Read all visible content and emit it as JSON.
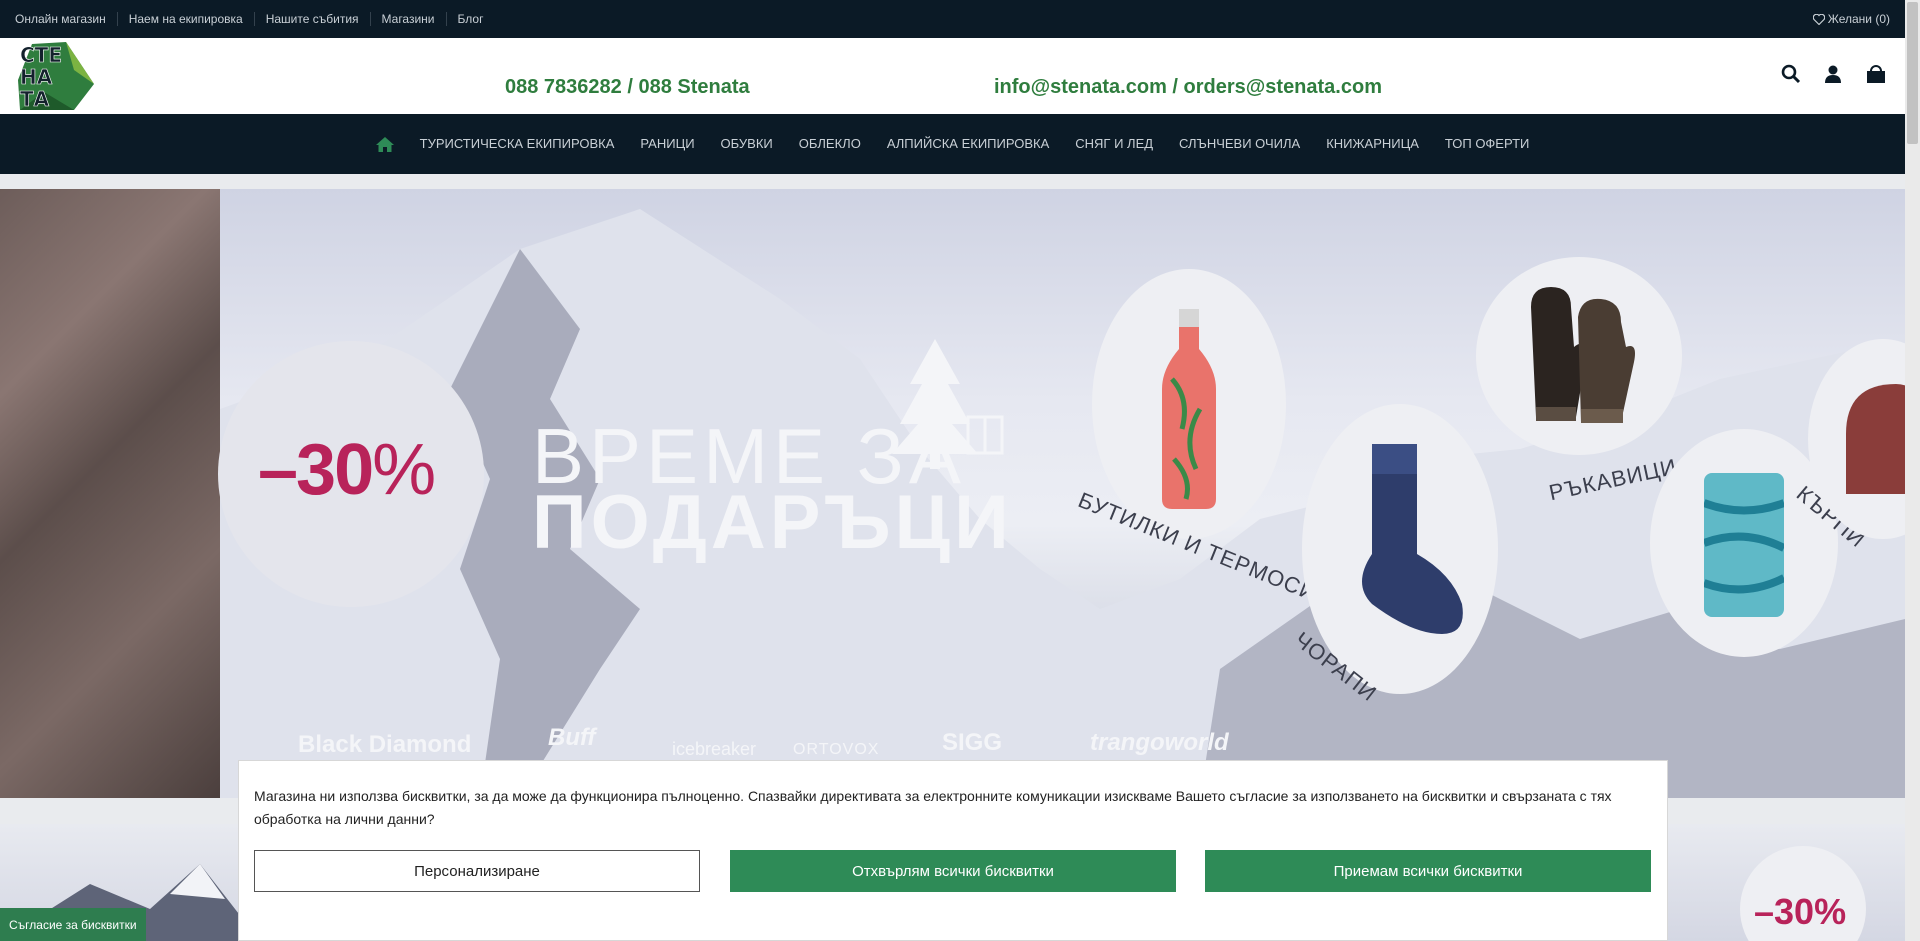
{
  "topbar": {
    "links": [
      "Онлайн магазин",
      "Наем на екипировка",
      "Нашите събития",
      "Магазини",
      "Блог"
    ],
    "wishlist": "Желани (0)"
  },
  "header": {
    "logo_text": "СТЕНАТА",
    "phone": "088  7836282 / 088 Stenata",
    "email": "info@stenata.com / orders@stenata.com",
    "icons": [
      "search-icon",
      "user-icon",
      "cart-icon"
    ]
  },
  "nav": {
    "items": [
      "ТУРИСТИЧЕСКА ЕКИПИРОВКА",
      "РАНИЦИ",
      "ОБУВКИ",
      "ОБЛЕКЛО",
      "АЛПИЙСКА ЕКИПИРОВКА",
      "СНЯГ И ЛЕД",
      "СЛЪНЧЕВИ ОЧИЛА",
      "КНИЖАРНИЦА",
      "ТОП ОФЕРТИ"
    ]
  },
  "banner": {
    "discount": "–30",
    "percent": "%",
    "title_line1": "ВРЕМЕ ЗА",
    "title_line2": "ПОДАРЪЦИ",
    "categories": [
      "БУТИЛКИ И ТЕРМОСИ",
      "РЪКАВИЦИ",
      "ЧОРАПИ",
      "КЪРПИ"
    ],
    "brands": [
      "Black Diamond",
      "Buff",
      "icebreaker",
      "ORTOVOX",
      "SIGG",
      "trangoworld"
    ]
  },
  "banner2": {
    "discount": "–30%"
  },
  "cookie": {
    "message": "Магазина ни използва бисквитки, за да може да функционира пълноценно. Спазвайки директивата за електронните комуникации изискваме Вашето съгласие за използването на бисквитки и свързаната с тях обработка на лични данни?",
    "customize": "Персонализиране",
    "reject": "Отхвърлям всички бисквитки",
    "accept": "Приемам всички бисквитки",
    "tab": "Съгласие за бисквитки"
  },
  "colors": {
    "dark": "#0b1a26",
    "green": "#2e8b57",
    "phone_green": "#2f7d3e",
    "magenta": "#b8235a"
  }
}
